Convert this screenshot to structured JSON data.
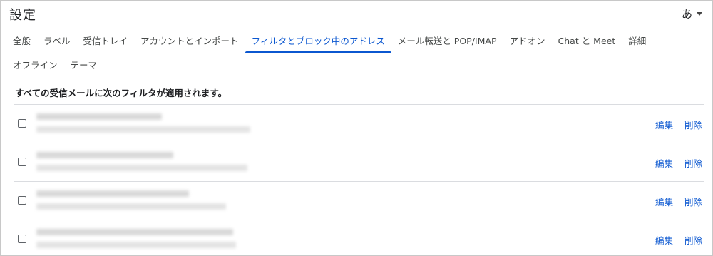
{
  "header": {
    "title": "設定",
    "ime_label": "あ"
  },
  "tabs": [
    {
      "label": "全般",
      "active": false
    },
    {
      "label": "ラベル",
      "active": false
    },
    {
      "label": "受信トレイ",
      "active": false
    },
    {
      "label": "アカウントとインポート",
      "active": false
    },
    {
      "label": "フィルタとブロック中のアドレス",
      "active": true
    },
    {
      "label": "メール転送と POP/IMAP",
      "active": false
    },
    {
      "label": "アドオン",
      "active": false
    },
    {
      "label": "Chat と Meet",
      "active": false
    },
    {
      "label": "詳細",
      "active": false
    },
    {
      "label": "オフライン",
      "active": false
    },
    {
      "label": "テーマ",
      "active": false
    }
  ],
  "filters": {
    "heading": "すべての受信メールに次のフィルタが適用されます。",
    "edit_label": "編集",
    "delete_label": "削除",
    "count_rows": 4
  },
  "colors": {
    "accent": "#0b57d0",
    "divider": "#dadce0",
    "text": "#202124"
  }
}
